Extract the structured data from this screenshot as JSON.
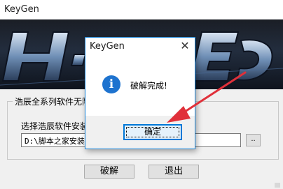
{
  "main_window": {
    "title": "KeyGen",
    "group_title": "浩辰全系列软件无限",
    "path_label": "选择浩辰软件安装",
    "path_value": "D:\\脚本之家安装",
    "browse_label": "..",
    "crack_label": "破解",
    "exit_label": "退出"
  },
  "dialog": {
    "title": "KeyGen",
    "close_glyph": "✕",
    "icon_glyph": "i",
    "message": "破解完成!",
    "ok_label": "确定"
  },
  "colors": {
    "annotation_arrow": "#e0303a",
    "dialog_border": "#1883d7",
    "info_icon": "#1e73cf"
  }
}
